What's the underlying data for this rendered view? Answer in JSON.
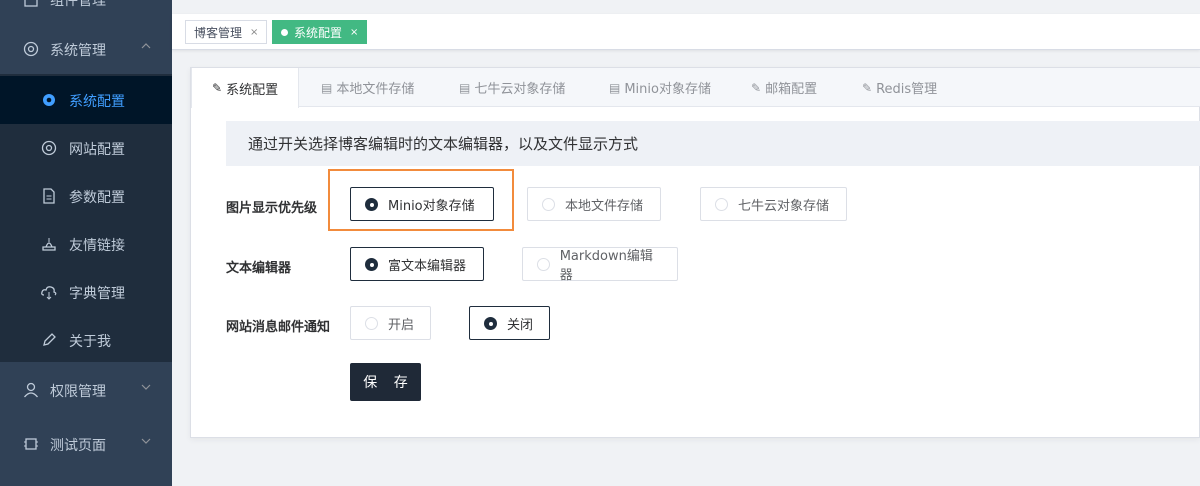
{
  "sidebar": {
    "top_partial_label": "组件管理",
    "system_mgmt": "系统管理",
    "items": [
      {
        "label": "系统配置",
        "icon": "gear-icon"
      },
      {
        "label": "网站配置",
        "icon": "gear-icon"
      },
      {
        "label": "参数配置",
        "icon": "document-icon"
      },
      {
        "label": "友情链接",
        "icon": "link-icon"
      },
      {
        "label": "字典管理",
        "icon": "cloud-icon"
      },
      {
        "label": "关于我",
        "icon": "edit-icon"
      }
    ],
    "permission_mgmt": "权限管理",
    "test_page": "测试页面"
  },
  "tags": [
    {
      "label": "博客管理"
    },
    {
      "label": "系统配置"
    }
  ],
  "tabs": [
    {
      "label": "系统配置",
      "icon": "edit-icon"
    },
    {
      "label": "本地文件存储",
      "icon": "calendar-icon"
    },
    {
      "label": "七牛云对象存储",
      "icon": "calendar-icon"
    },
    {
      "label": "Minio对象存储",
      "icon": "calendar-icon"
    },
    {
      "label": "邮箱配置",
      "icon": "edit-icon"
    },
    {
      "label": "Redis管理",
      "icon": "edit-icon"
    }
  ],
  "alert": "通过开关选择博客编辑时的文本编辑器，以及文件显示方式",
  "form": {
    "image_priority": {
      "label": "图片显示优先级",
      "options": [
        "Minio对象存储",
        "本地文件存储",
        "七牛云对象存储"
      ],
      "selected": "Minio对象存储"
    },
    "editor": {
      "label": "文本编辑器",
      "options": [
        "富文本编辑器",
        "Markdown编辑器"
      ],
      "selected": "富文本编辑器"
    },
    "email_notify": {
      "label": "网站消息邮件通知",
      "options": [
        "开启",
        "关闭"
      ],
      "selected": "关闭"
    },
    "save_label": "保 存"
  },
  "colors": {
    "sidebar_bg": "#304156",
    "submenu_bg": "#1f2d3d",
    "active_text": "#409eff",
    "tag_active": "#42b983",
    "highlight": "#f28b3c",
    "button_bg": "#1f2937"
  }
}
